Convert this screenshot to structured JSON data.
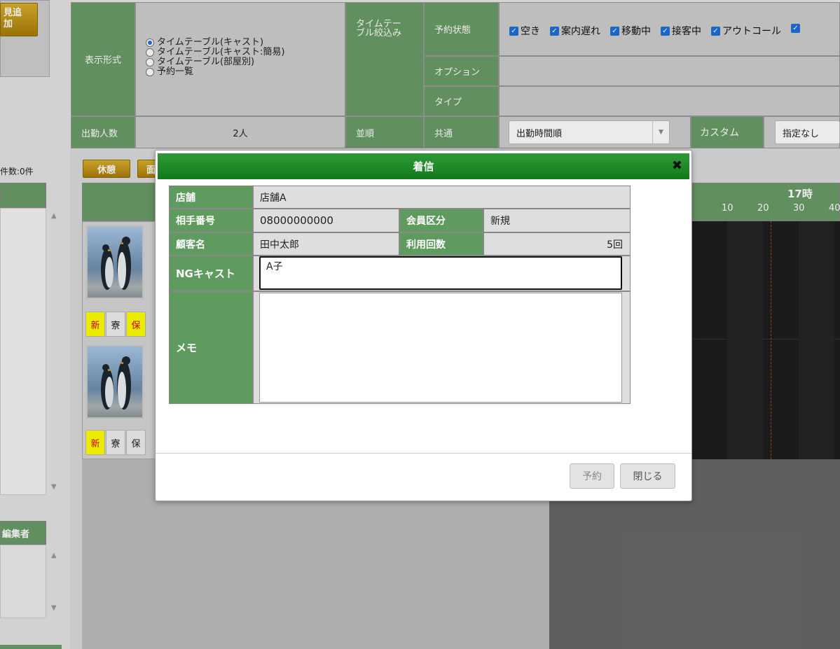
{
  "left_panel": {
    "top_button": "見追\n加",
    "count_text": "件数:0件",
    "editor_header": "編集者"
  },
  "filter": {
    "display_format_label": "表示形式",
    "radio_options": [
      {
        "label": "タイムテーブル(キャスト)",
        "selected": true
      },
      {
        "label": "タイムテーブル(キャスト:簡易)",
        "selected": false
      },
      {
        "label": "タイムテーブル(部屋別)",
        "selected": false
      },
      {
        "label": "予約一覧",
        "selected": false
      }
    ],
    "timetable_filter_label": "タイムテーブル絞込み",
    "reservation_status_label": "予約状態",
    "status_checkboxes": [
      "空き",
      "案内遅れ",
      "移動中",
      "接客中",
      "アウトコール"
    ],
    "option_label": "オプション",
    "type_label": "タイプ",
    "attendance_label": "出勤人数",
    "attendance_value": "2人",
    "order_label": "並順",
    "common_label": "共通",
    "common_select_value": "出勤時間順",
    "custom_label": "カスタム",
    "custom_select_value": "指定なし"
  },
  "toolbar": {
    "break_button": "休憩",
    "second_button": "面"
  },
  "timeline": {
    "hour_label": "17時",
    "minute_ticks": [
      "10",
      "20",
      "30",
      "40"
    ]
  },
  "cast_cards": [
    {
      "tags": [
        "新",
        "寮",
        "保"
      ]
    },
    {
      "tags": [
        "新",
        "寮",
        "保"
      ]
    }
  ],
  "modal": {
    "title": "着信",
    "store_label": "店舗",
    "store_value": "店舗A",
    "phone_label": "相手番号",
    "phone_value": "08000000000",
    "member_type_label": "会員区分",
    "member_type_value": "新規",
    "customer_label": "顧客名",
    "customer_value": "田中太郎",
    "usage_label": "利用回数",
    "usage_value": "5回",
    "ng_cast_label": "NGキャスト",
    "ng_cast_value": "A子",
    "memo_label": "メモ",
    "memo_value": "",
    "reserve_button": "予約",
    "close_button": "閉じる"
  },
  "colors": {
    "header_green": "#6b9c68",
    "modal_title_green": "#1f8a27",
    "gold_button": "#c39a1a"
  }
}
